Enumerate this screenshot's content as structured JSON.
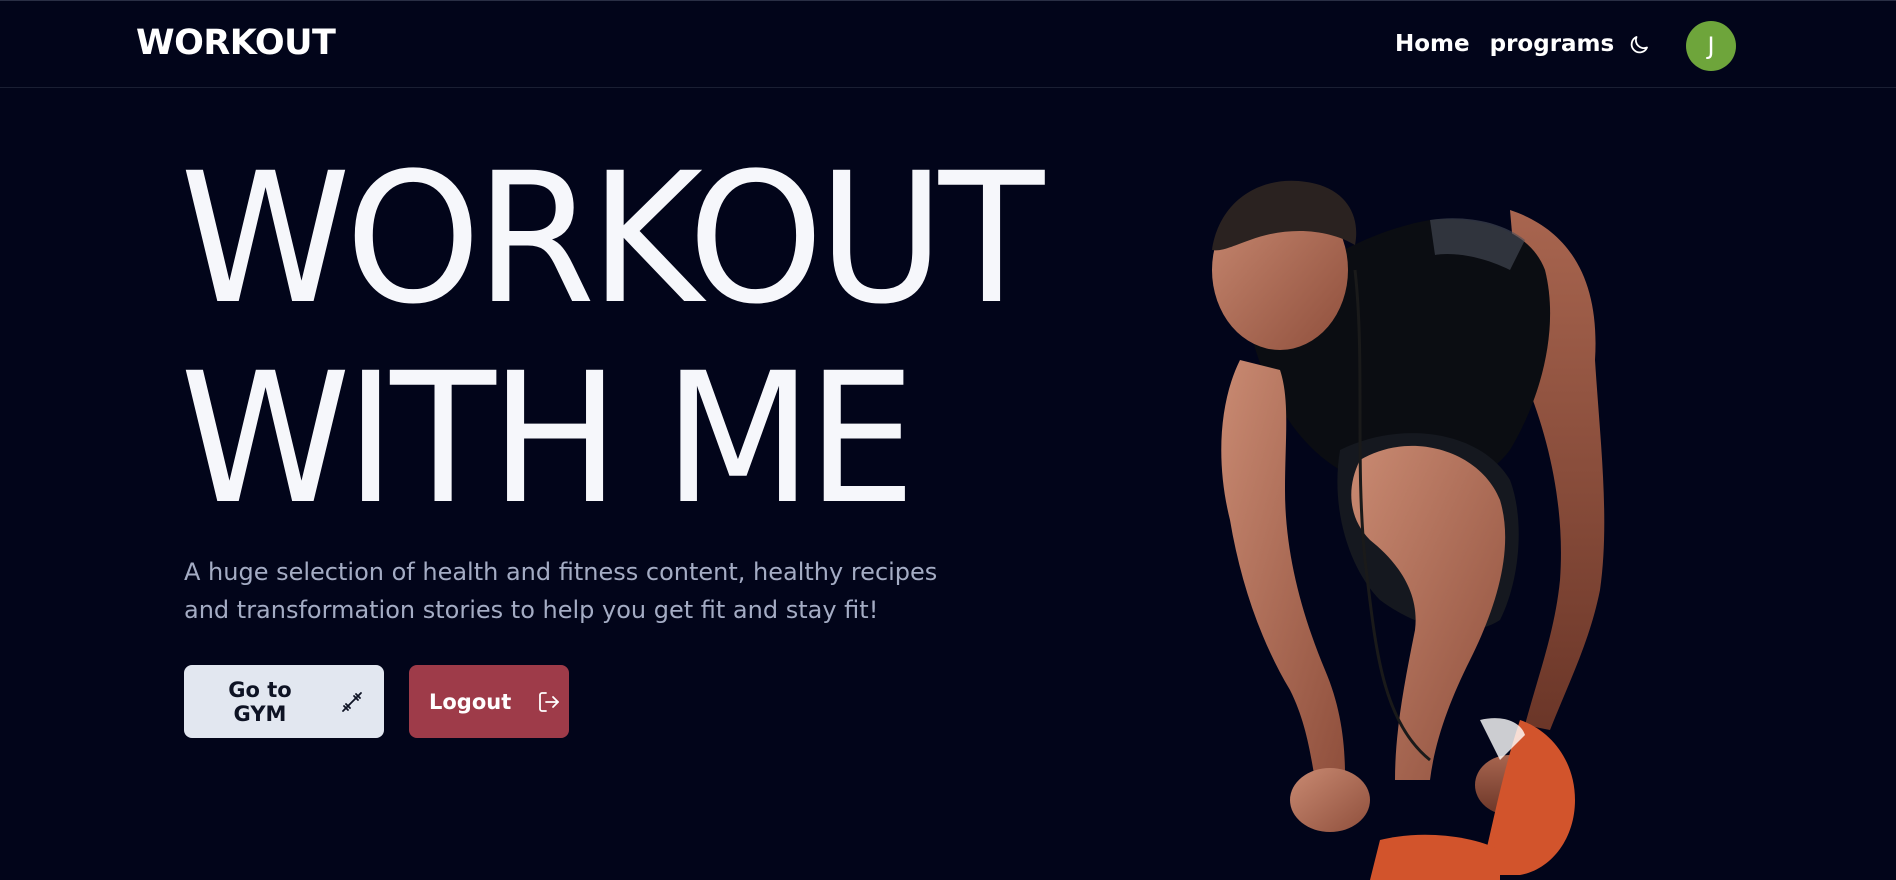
{
  "navbar": {
    "brand": "WORKOUT",
    "links": [
      {
        "label": "Home"
      },
      {
        "label": "programs"
      }
    ],
    "theme_icon": "moon-icon",
    "avatar_initial": "J",
    "avatar_color": "#6ea53b"
  },
  "hero": {
    "title_line1": "WORKOUT",
    "title_line2": "WITH ME",
    "subtitle": "A huge selection of health and fitness content, healthy recipes and transformation stories to help you get fit and stay fit!",
    "primary_button": {
      "label": "Go to GYM",
      "icon": "dumbbell-icon",
      "color": "#e2e7f0"
    },
    "secondary_button": {
      "label": "Logout",
      "icon": "logout-icon",
      "color": "#9e3b49"
    },
    "image": "athlete-tying-shoe"
  },
  "colors": {
    "background": "#02051a",
    "subtitle": "#a4acc4"
  }
}
